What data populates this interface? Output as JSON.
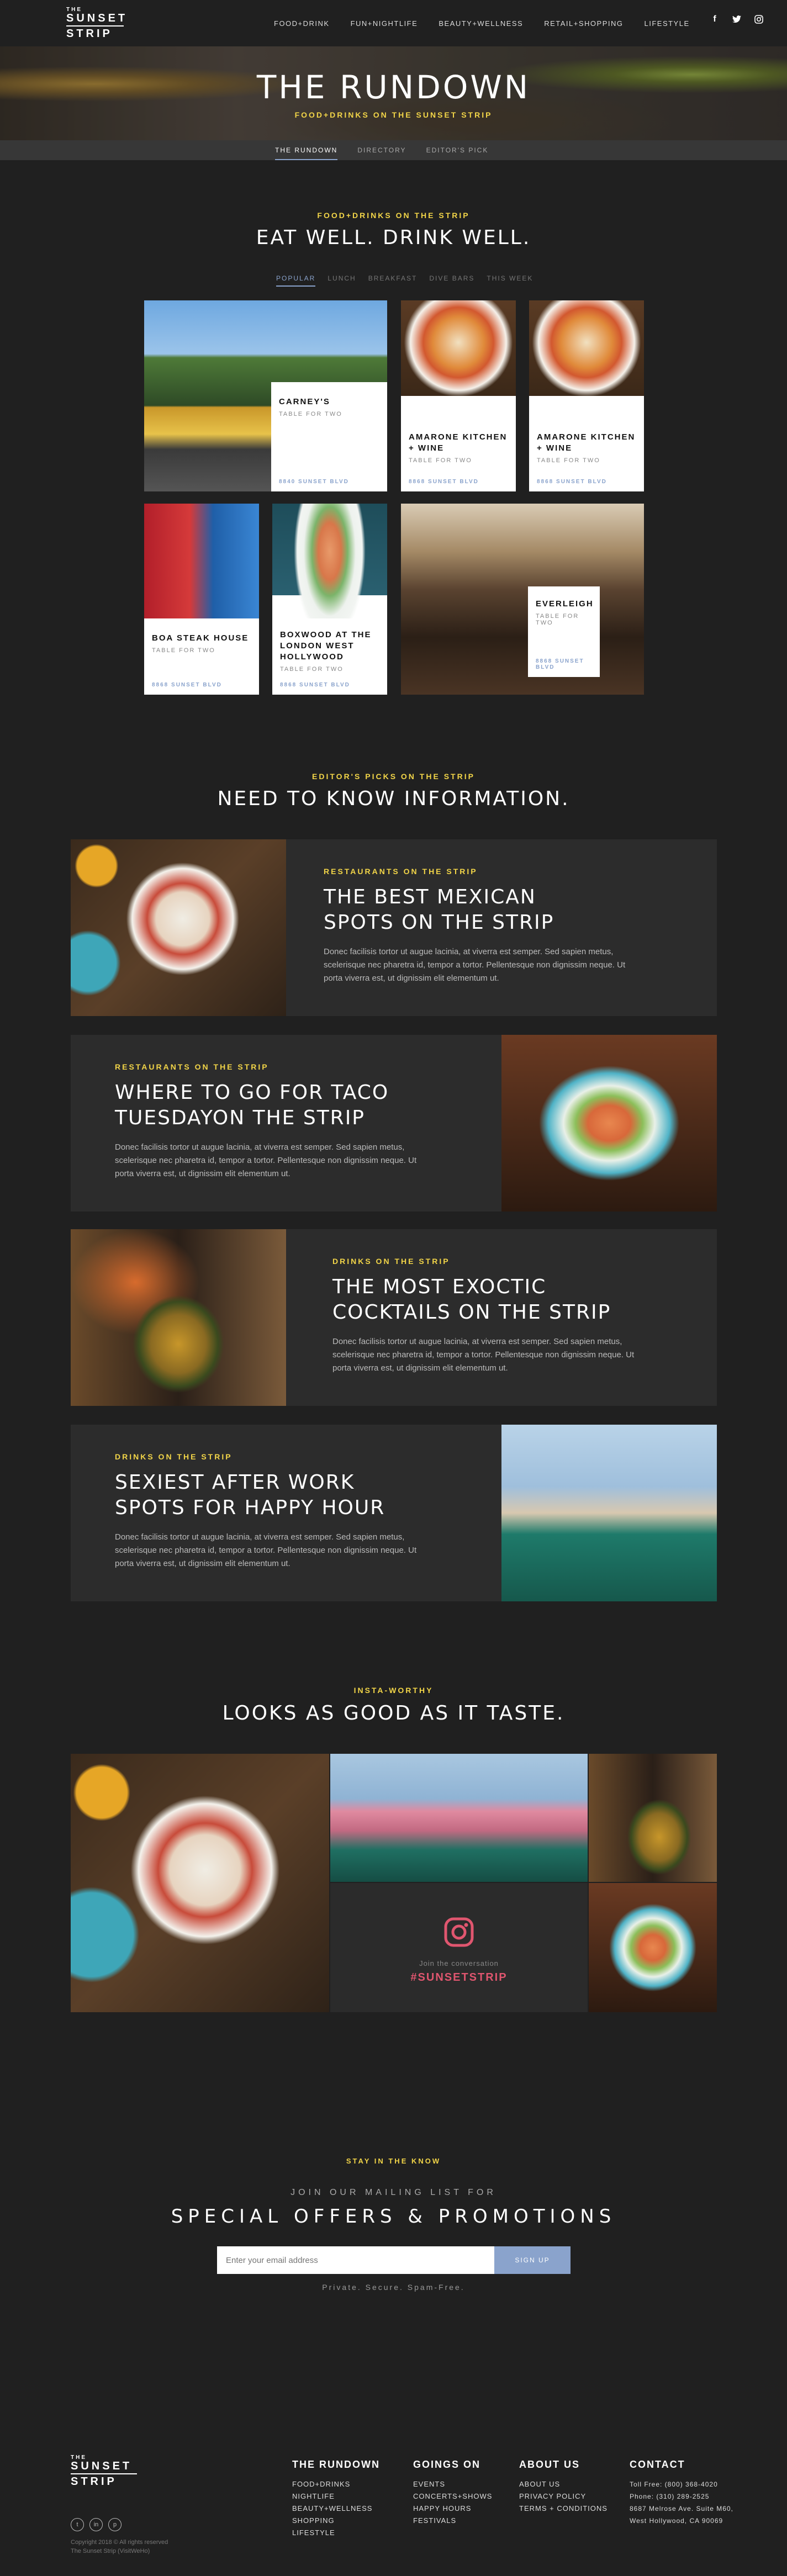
{
  "header": {
    "logo": {
      "line1": "THE",
      "line2": "SUNSET",
      "line3": "STRIP"
    },
    "nav": [
      "FOOD+DRINK",
      "FUN+NIGHTLIFE",
      "BEAUTY+WELLNESS",
      "RETAIL+SHOPPING",
      "LIFESTYLE"
    ],
    "social": {
      "facebook": "f",
      "twitter": "t",
      "instagram": "◎"
    }
  },
  "hero": {
    "title": "THE RUNDOWN",
    "subtitle": "FOOD+DRINKS ON THE SUNSET STRIP"
  },
  "subnav": {
    "items": [
      "THE RUNDOWN",
      "DIRECTORY",
      "EDITOR'S PICK"
    ],
    "active": "THE RUNDOWN"
  },
  "eat": {
    "eyebrow": "FOOD+DRINKS ON THE STRIP",
    "title": "EAT WELL. DRINK WELL.",
    "filters": [
      "POPULAR",
      "LUNCH",
      "BREAKFAST",
      "DIVE BARS",
      "THIS WEEK"
    ],
    "cards": [
      {
        "name": "CARNEY'S",
        "meta": "TABLE FOR TWO",
        "link": "8840 SUNSET BLVD"
      },
      {
        "name": "AMARONE KITCHEN + WINE",
        "meta": "TABLE FOR TWO",
        "link": "8868 SUNSET BLVD"
      },
      {
        "name": "AMARONE KITCHEN + WINE",
        "meta": "TABLE FOR TWO",
        "link": "8868 SUNSET BLVD"
      },
      {
        "name": "BOA STEAK HOUSE",
        "meta": "TABLE FOR TWO",
        "link": "8868 SUNSET BLVD"
      },
      {
        "name": "BOXWOOD AT THE LONDON WEST HOLLYWOOD",
        "meta": "TABLE FOR TWO",
        "link": "8868 SUNSET BLVD"
      },
      {
        "name": "EVERLEIGH",
        "meta": "TABLE FOR TWO",
        "link": "8868 SUNSET BLVD"
      }
    ]
  },
  "editors": {
    "eyebrow": "EDITOR'S PICKS ON THE STRIP",
    "title": "NEED TO KNOW INFORMATION.",
    "features": [
      {
        "category": "RESTAURANTS  ON THE STRIP",
        "title": "THE BEST MEXICAN SPOTS ON THE STRIP",
        "body": "Donec facilisis tortor ut augue lacinia, at viverra est semper. Sed sapien metus, scelerisque nec pharetra id, tempor a tortor. Pellentesque non dignissim neque. Ut porta viverra est, ut dignissim elit elementum ut."
      },
      {
        "category": "RESTAURANTS  ON THE STRIP",
        "title": "WHERE TO GO FOR TACO TUESDAYON THE STRIP",
        "body": "Donec facilisis tortor ut augue lacinia, at viverra est semper. Sed sapien metus, scelerisque nec pharetra id, tempor a tortor. Pellentesque non dignissim neque. Ut porta viverra est, ut dignissim elit elementum ut."
      },
      {
        "category": "DRINKS  ON THE STRIP",
        "title": "THE MOST EXOCTIC COCKTAILS ON THE STRIP",
        "body": "Donec facilisis tortor ut augue lacinia, at viverra est semper. Sed sapien metus, scelerisque nec pharetra id, tempor a tortor. Pellentesque non dignissim neque. Ut porta viverra est, ut dignissim elit elementum ut."
      },
      {
        "category": "DRINKS  ON THE STRIP",
        "title": "SEXIEST AFTER WORK SPOTS FOR HAPPY HOUR",
        "body": "Donec facilisis tortor ut augue lacinia, at viverra est semper. Sed sapien metus, scelerisque nec pharetra id, tempor a tortor. Pellentesque non dignissim neque. Ut porta viverra est, ut dignissim elit elementum ut."
      }
    ]
  },
  "insta": {
    "eyebrow": "INSTA-WORTHY",
    "title": "LOOKS AS GOOD AS IT TASTE.",
    "join": "Join the conversation",
    "hashtag": "#SUNSETSTRIP"
  },
  "newsletter": {
    "eyebrow": "STAY IN THE KNOW",
    "join": "JOIN OUR MAILING LIST FOR",
    "headline": "SPECIAL OFFERS & PROMOTIONS",
    "placeholder": "Enter your email address",
    "button": "SIGN UP",
    "note": "Private. Secure. Spam-Free."
  },
  "footer": {
    "copyright": "Copyright 2018 © All rights reserved",
    "company": "The Sunset Strip (VisitWeHo)",
    "rundown": {
      "title": "THE RUNDOWN",
      "items": [
        "FOOD+DRINKS",
        "NIGHTLIFE",
        "BEAUTY+WELLNESS",
        "SHOPPING",
        "LIFESTYLE"
      ]
    },
    "goings": {
      "title": "GOINGS ON",
      "items": [
        "EVENTS",
        "CONCERTS+SHOWS",
        "HAPPY HOURS",
        "FESTIVALS"
      ]
    },
    "about": {
      "title": "ABOUT US",
      "items": [
        "ABOUT US",
        "PRIVACY POLICY",
        "TERMS + CONDITIONS"
      ]
    },
    "contact": {
      "title": "CONTACT",
      "items": [
        "Toll Free: (800) 368-4020",
        "Phone: (310) 289-2525",
        "8687 Melrose Ave. Suite M60,",
        "West Hollywood, CA 90069"
      ]
    }
  },
  "colors": {
    "accent_yellow": "#f2d548",
    "accent_blue": "#8aa3cc",
    "background": "#202020",
    "panel": "#2c2c2c",
    "hashtag": "#e0566f"
  }
}
